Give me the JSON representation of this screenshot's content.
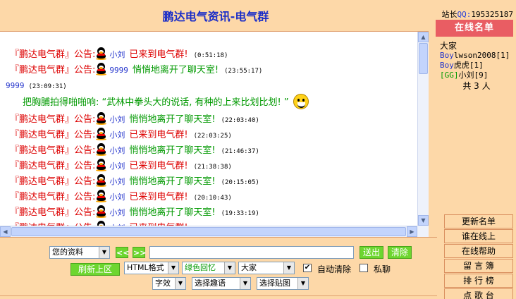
{
  "title": "鹏达电气资讯-电气群",
  "webmaster": {
    "label": "站长",
    "qq_label": "QQ:",
    "qq_number": "195325187"
  },
  "chat": {
    "messages": [
      {
        "room": "『鹏达电气群』公告:",
        "user": "小刘",
        "action": "已来到电气群!",
        "action_color": "red",
        "time": "(0:51:18)"
      },
      {
        "room": "『鹏达电气群』公告:",
        "user": "9999",
        "action": "悄悄地离开了聊天室!",
        "action_color": "green",
        "time": "(23:55:17)"
      }
    ],
    "user_line": {
      "user": "9999",
      "time": "(23:09:31)"
    },
    "emote": "把胸脯拍得啪啪响: “武林中拳头大的说话, 有种的上来比划比划! ”",
    "messages2": [
      {
        "room": "『鹏达电气群』公告:",
        "user": "小刘",
        "action": "悄悄地离开了聊天室!",
        "action_color": "green",
        "time": "(22:03:40)"
      },
      {
        "room": "『鹏达电气群』公告:",
        "user": "小刘",
        "action": "已来到电气群!",
        "action_color": "red",
        "time": "(22:03:25)"
      },
      {
        "room": "『鹏达电气群』公告:",
        "user": "小刘",
        "action": "悄悄地离开了聊天室!",
        "action_color": "green",
        "time": "(21:46:37)"
      },
      {
        "room": "『鹏达电气群』公告:",
        "user": "小刘",
        "action": "已来到电气群!",
        "action_color": "red",
        "time": "(21:38:38)"
      },
      {
        "room": "『鹏达电气群』公告:",
        "user": "小刘",
        "action": "悄悄地离开了聊天室!",
        "action_color": "green",
        "time": "(20:15:05)"
      },
      {
        "room": "『鹏达电气群』公告:",
        "user": "小刘",
        "action": "已来到电气群!",
        "action_color": "red",
        "time": "(20:10:43)"
      },
      {
        "room": "『鹏达电气群』公告:",
        "user": "小刘",
        "action": "悄悄地离开了聊天室!",
        "action_color": "green",
        "time": "(19:33:19)"
      },
      {
        "room": "『鹏达电气群』公告:",
        "user": "小刘",
        "action": "已来到电气群!",
        "action_color": "red",
        "time": ""
      }
    ]
  },
  "online": {
    "header": "在线名单",
    "all": "大家",
    "users": [
      {
        "tag": "Boy",
        "name": "lwson2008[1]"
      },
      {
        "tag": "Boy",
        "name": "虎虎[1]"
      },
      {
        "tag": "[GG]",
        "name": "小刘[9]"
      }
    ],
    "count": "共 3 人"
  },
  "side_buttons": [
    "更新名单",
    "谁在线上",
    "在线帮助",
    "留 言 簿",
    "排 行 榜",
    "点 歌 台"
  ],
  "controls": {
    "profile_select": "您的资料",
    "prev": "<<",
    "next": ">>",
    "message_value": "",
    "send": "送出",
    "clear": "清除",
    "refresh": "刷新上区",
    "format_select": "HTML格式",
    "color_select": "绿色回忆",
    "target_select": "大家",
    "auto_clear_label": "自动清除",
    "auto_clear_checked": true,
    "private_label": "私聊",
    "private_checked": false,
    "font_select": "字效",
    "fun_select": "选择趣语",
    "sticker_select": "选择贴图"
  },
  "colors": {
    "title": "#1a2dc8",
    "announcement_red": "#dd0000",
    "announcement_green": "#009900",
    "user_blue": "#2233cc",
    "online_header": "#e95d63",
    "button_green": "#6dd62f",
    "background": "#fdd8a8"
  }
}
